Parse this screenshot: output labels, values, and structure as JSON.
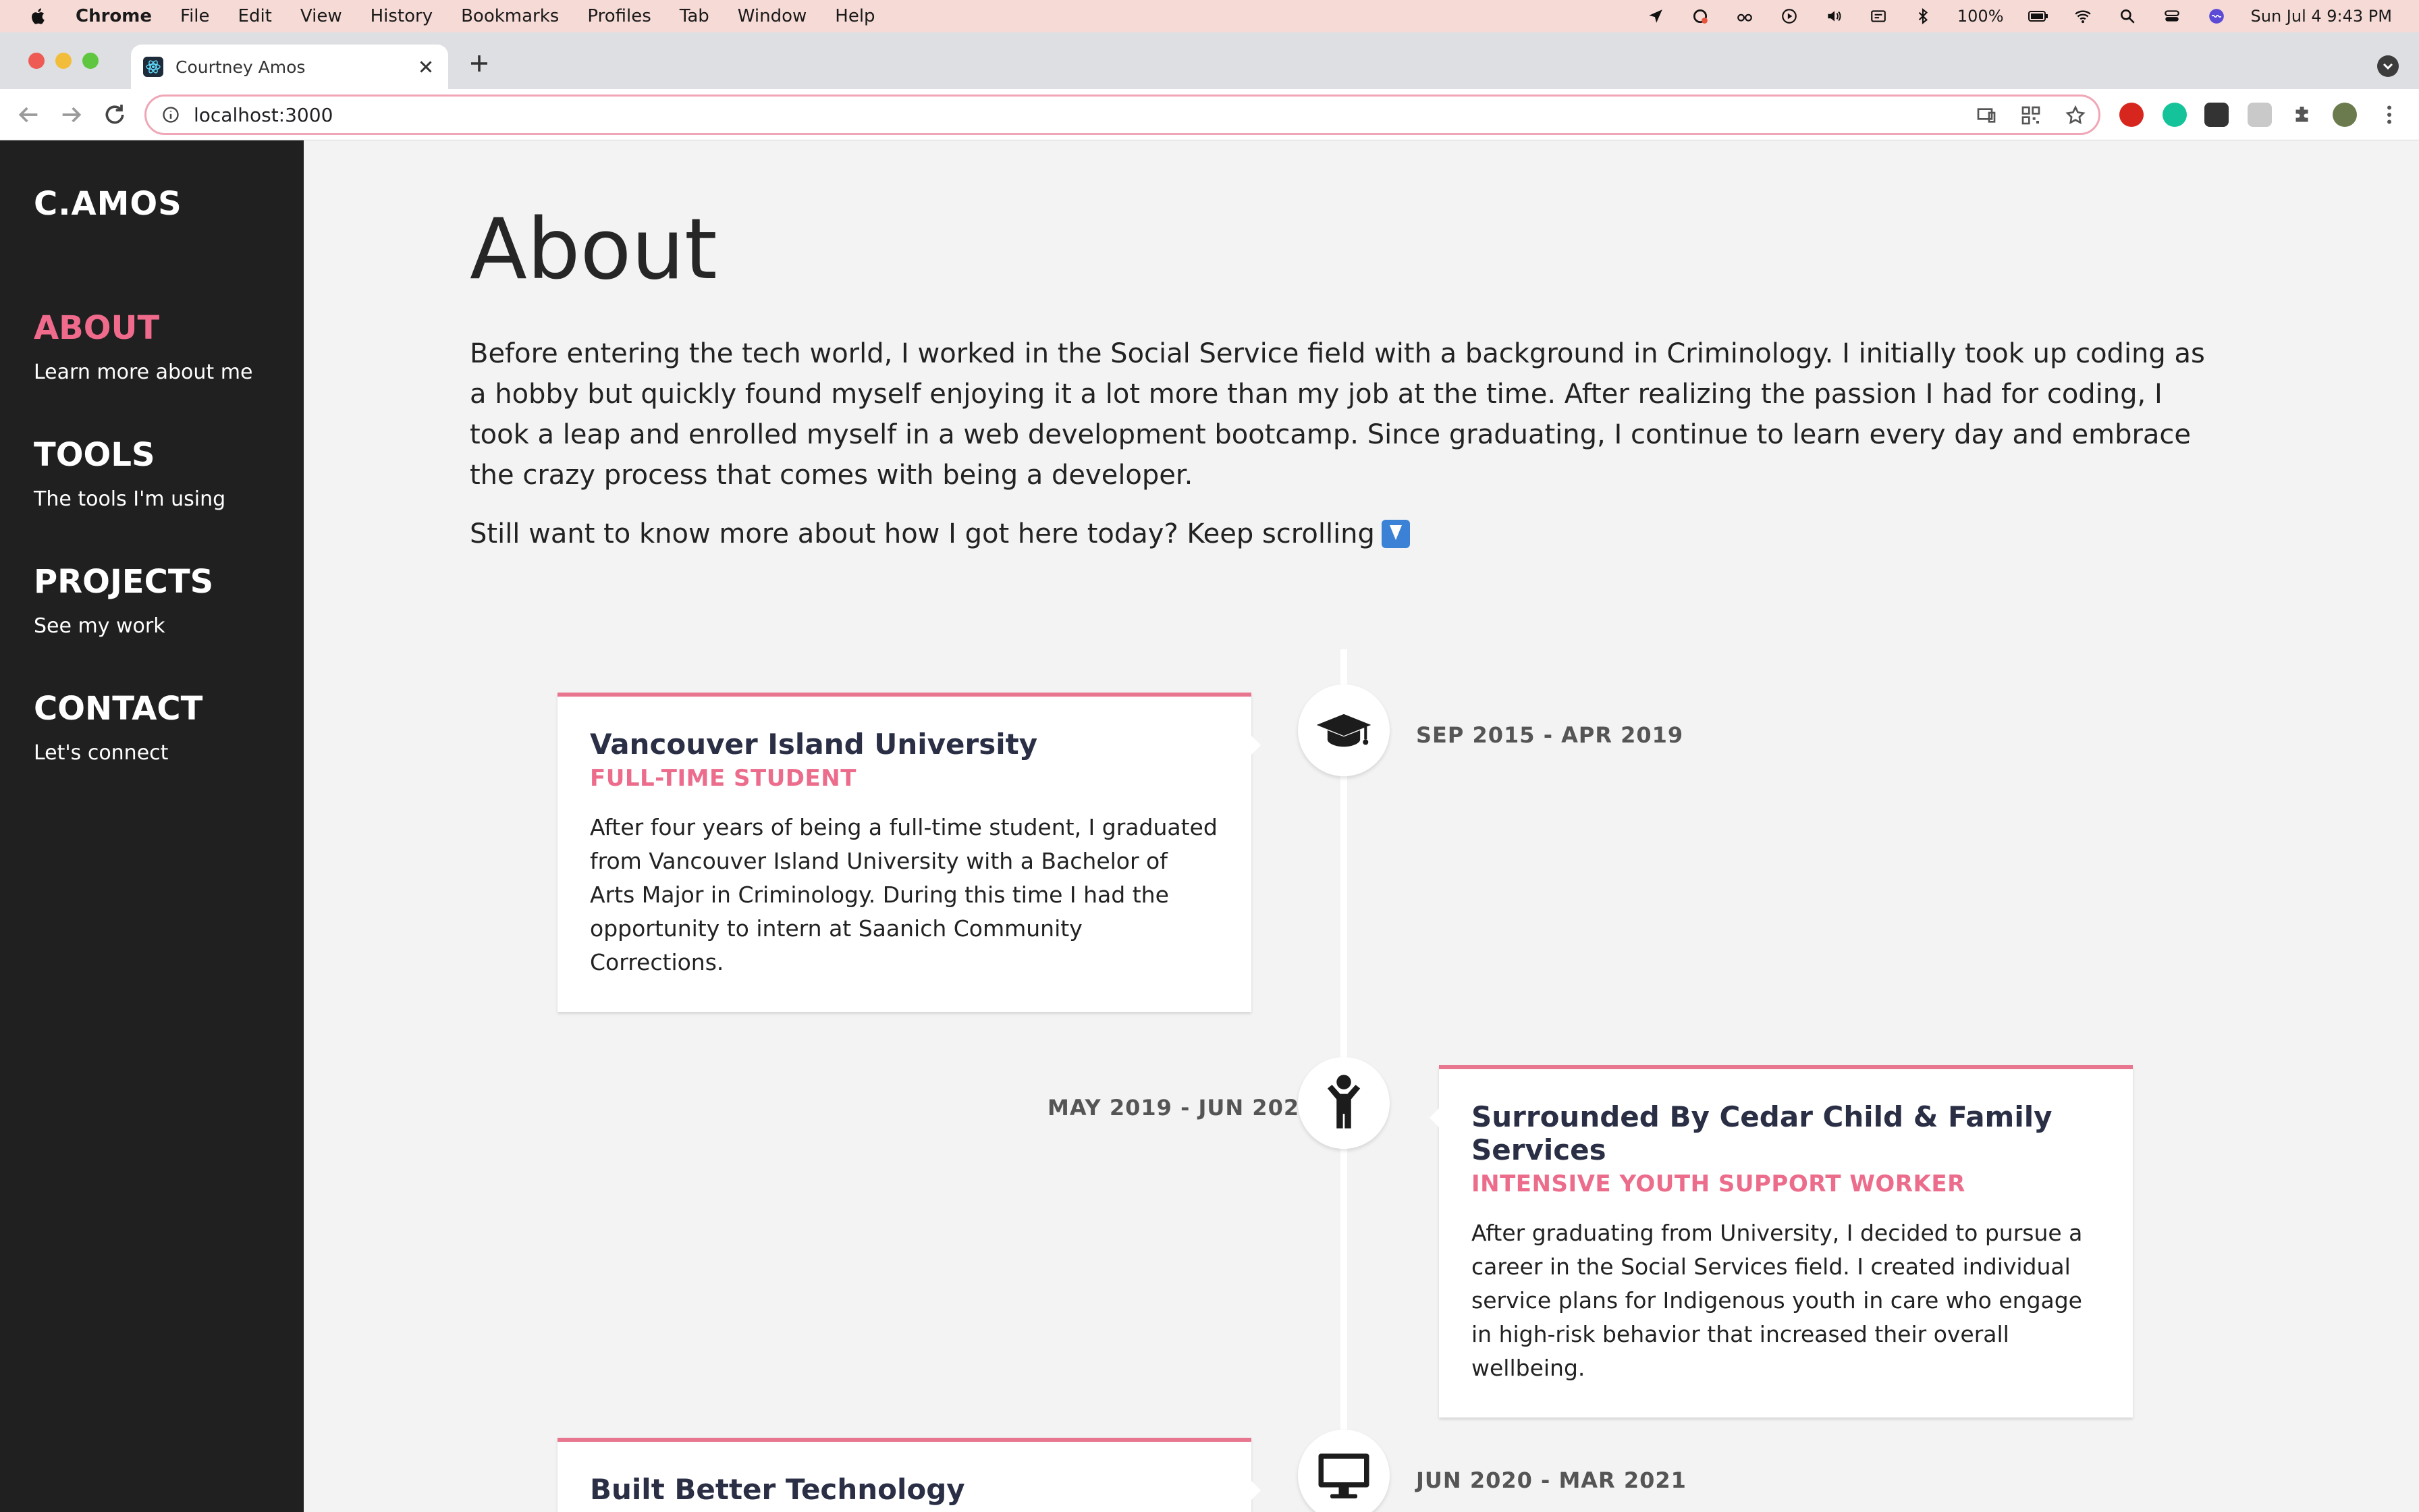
{
  "menubar": {
    "app": "Chrome",
    "items": [
      "File",
      "Edit",
      "View",
      "History",
      "Bookmarks",
      "Profiles",
      "Tab",
      "Window",
      "Help"
    ],
    "battery": "100%",
    "clock": "Sun Jul 4  9:43 PM"
  },
  "browser": {
    "tab_title": "Courtney Amos",
    "url": "localhost:3000"
  },
  "sidebar": {
    "logo": "C.AMOS",
    "items": [
      {
        "title": "ABOUT",
        "subtitle": "Learn more about me",
        "active": true
      },
      {
        "title": "TOOLS",
        "subtitle": "The tools I'm using",
        "active": false
      },
      {
        "title": "PROJECTS",
        "subtitle": "See my work",
        "active": false
      },
      {
        "title": "CONTACT",
        "subtitle": "Let's connect",
        "active": false
      }
    ]
  },
  "about": {
    "title": "About",
    "intro": "Before entering the tech world, I worked in the Social Service field with a background in Criminology. I initially took up coding as a hobby but quickly found myself enjoying it a lot more than my job at the time. After realizing the passion I had for coding, I took a leap and enrolled myself in a web development bootcamp. Since graduating, I continue to learn every day and embrace the crazy process that comes with being a developer.",
    "cta": "Still want to know more about how I got here today? Keep scrolling"
  },
  "timeline": [
    {
      "icon": "graduation-cap-icon",
      "date": "SEP 2015 - APR 2019",
      "title": "Vancouver Island University",
      "role": "FULL-TIME STUDENT",
      "description": "After four years of being a full-time student, I graduated from Vancouver Island University with a Bachelor of Arts Major in Criminology. During this time I had the opportunity to intern at Saanich Community Corrections."
    },
    {
      "icon": "child-icon",
      "date": "MAY 2019 - JUN 2020",
      "title": "Surrounded By Cedar Child & Family Services",
      "role": "INTENSIVE YOUTH SUPPORT WORKER",
      "description": "After graduating from University, I decided to pursue a career in the Social Services field. I created individual service plans for Indigenous youth in care who engage in high-risk behavior that increased their overall wellbeing."
    },
    {
      "icon": "desktop-icon",
      "date": "JUN 2020 - MAR 2021",
      "title": "Built Better Technology",
      "role": "",
      "description": ""
    }
  ],
  "colors": {
    "accent": "#ec6c8c",
    "sidebar_bg": "#202020",
    "page_bg": "#f3f3f3",
    "card_title": "#2a2f45"
  }
}
